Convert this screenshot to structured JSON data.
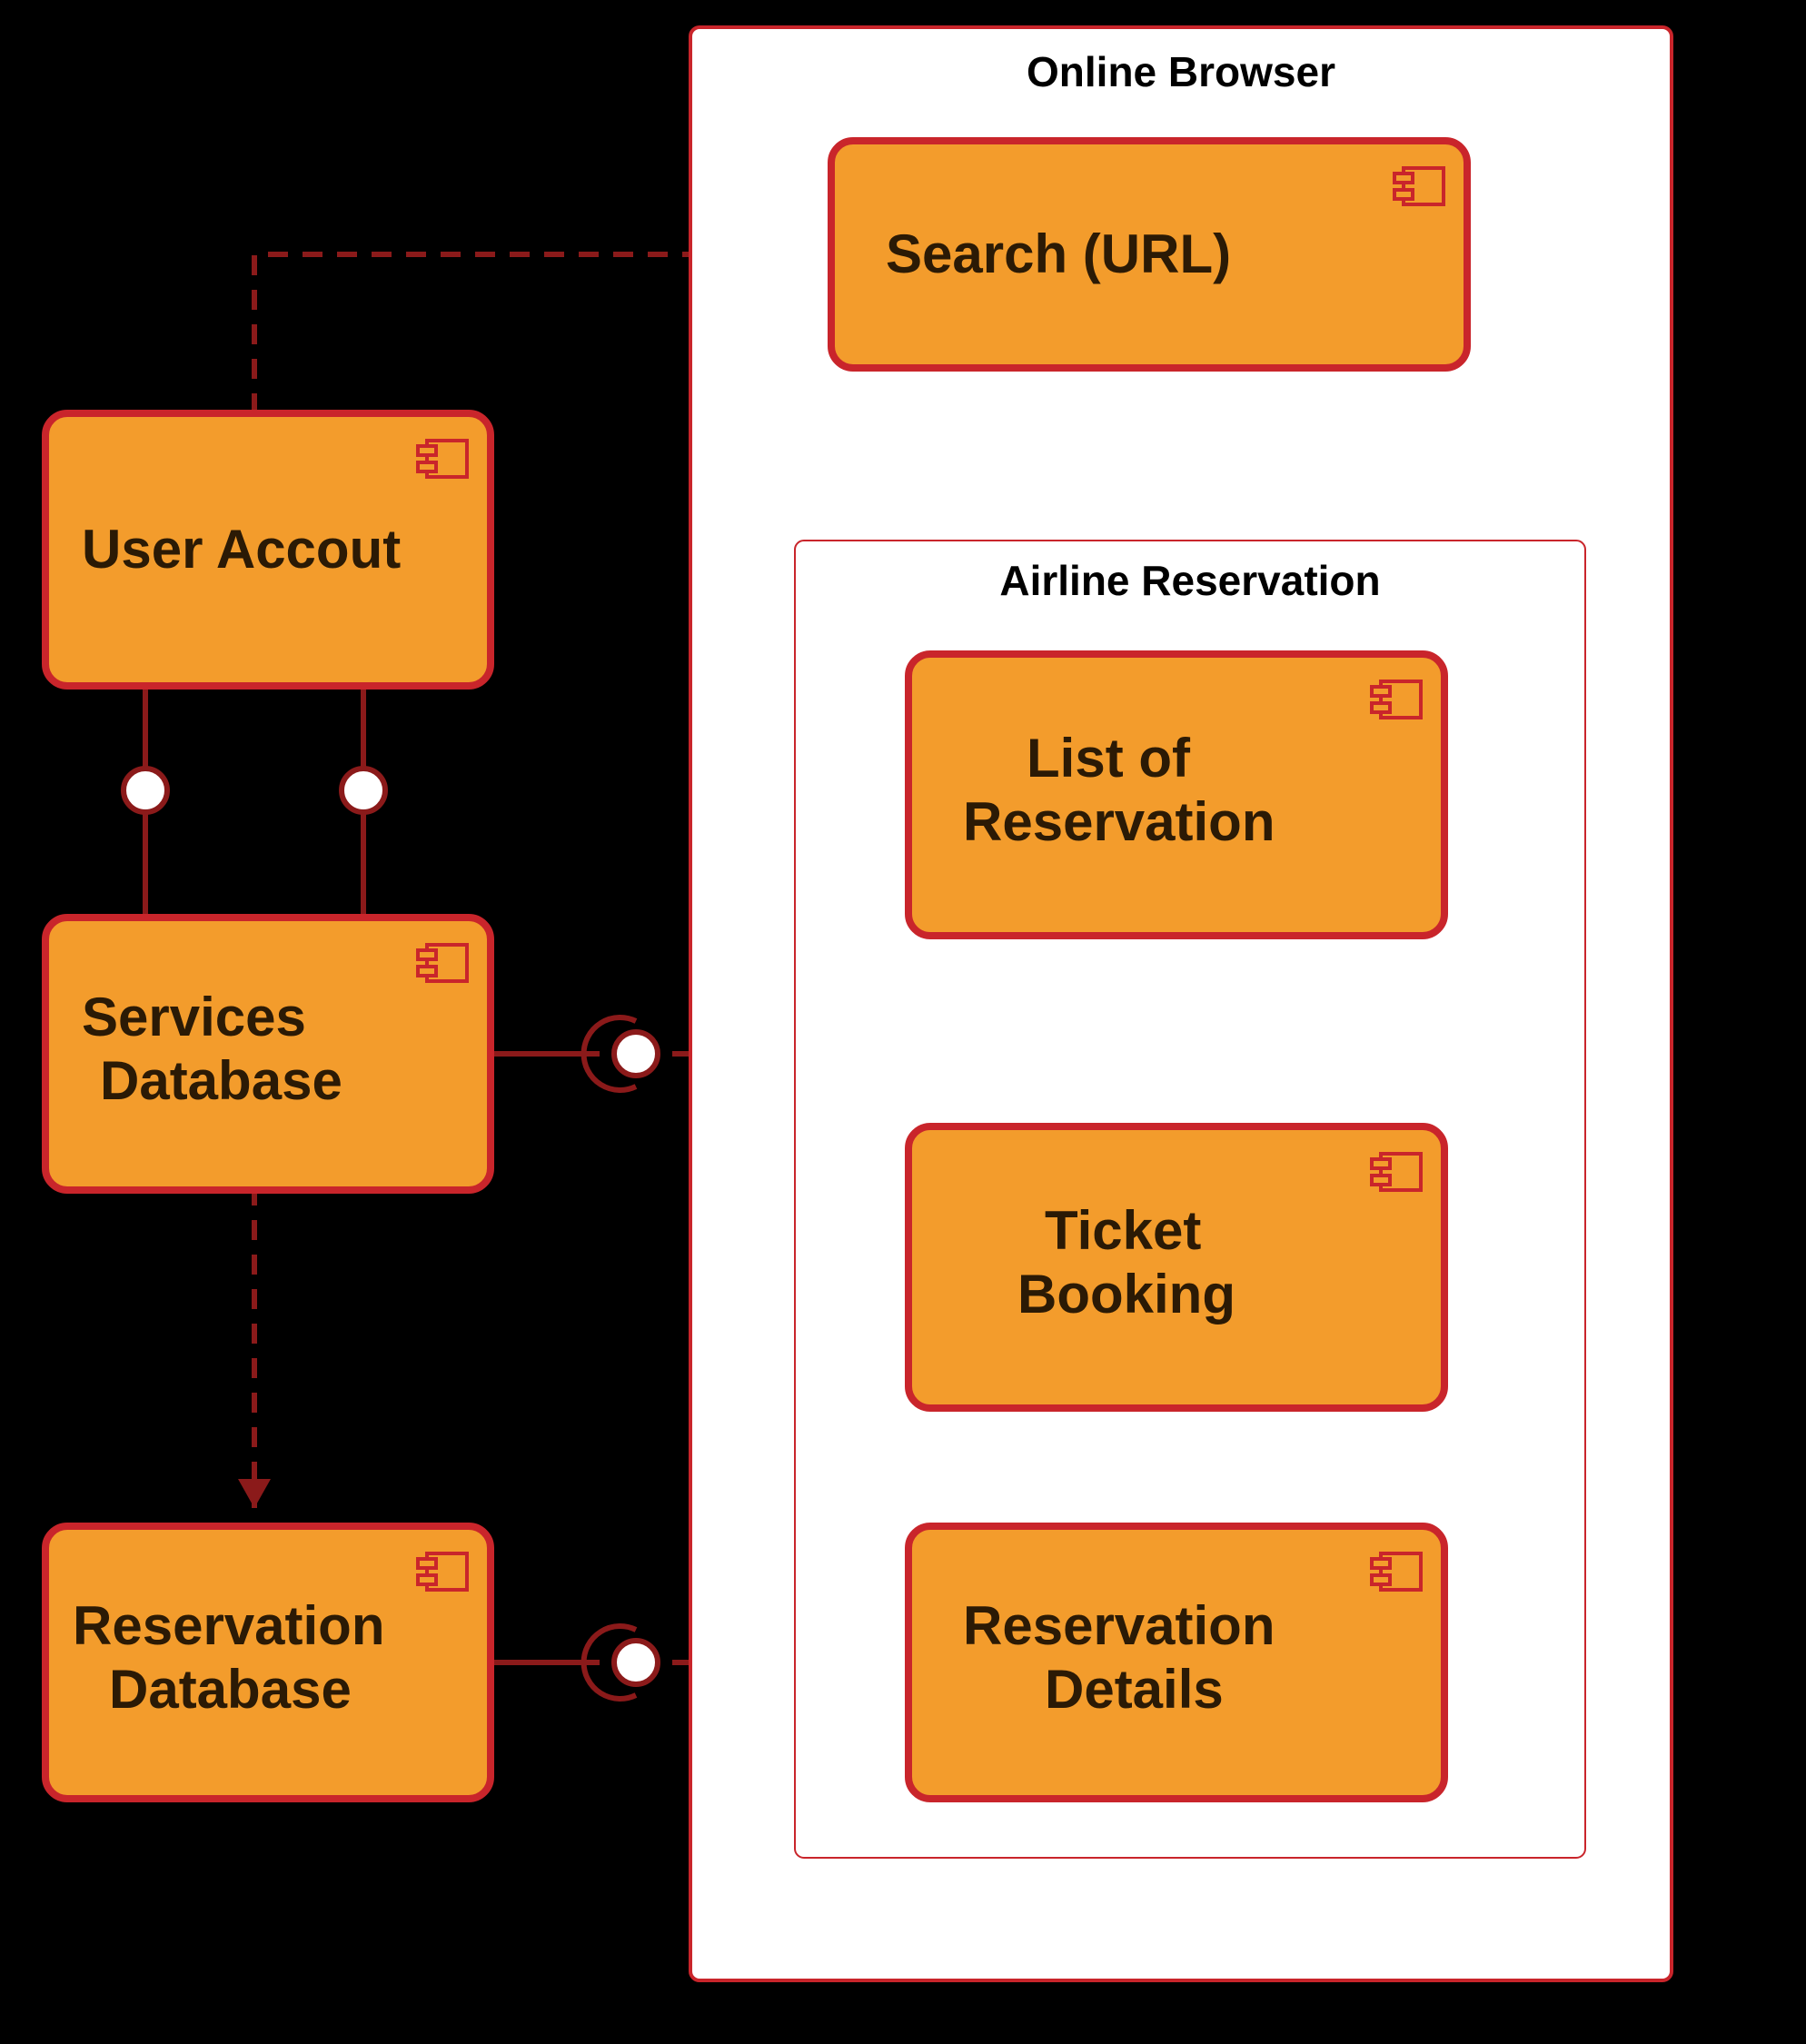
{
  "outer_frame": {
    "title": "Online Browser"
  },
  "inner_frame": {
    "title": "Airline Reservation"
  },
  "components": {
    "user_account": {
      "line1": "User Accout"
    },
    "services_db": {
      "line1": "Services",
      "line2": "Database"
    },
    "reservation_db": {
      "line1": "Reservation",
      "line2": "Database"
    },
    "search": {
      "line1": "Search (URL)"
    },
    "list_reservation": {
      "line1": "List of",
      "line2": "Reservation"
    },
    "ticket_booking": {
      "line1": "Ticket",
      "line2": "Booking"
    },
    "reservation_detail": {
      "line1": "Reservation",
      "line2": "Details"
    }
  }
}
